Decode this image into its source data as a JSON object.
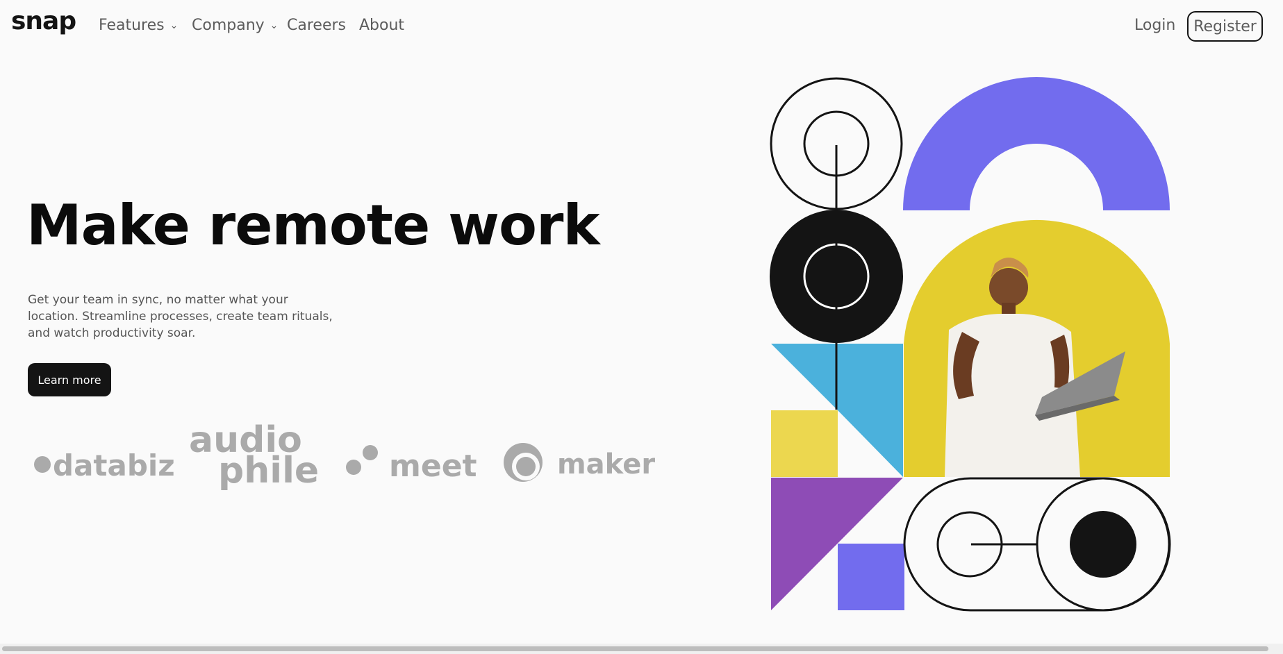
{
  "nav": {
    "logo": "snap",
    "items": [
      {
        "label": "Features",
        "chevron": "⌄"
      },
      {
        "label": "Company",
        "chevron": "⌄"
      },
      {
        "label": "Careers"
      },
      {
        "label": "About"
      }
    ],
    "login": "Login",
    "register": "Register"
  },
  "hero": {
    "title": "Make remote work",
    "text": "Get your team in sync, no matter what your location. Streamline processes, create team rituals, and watch productivity soar.",
    "cta": "Learn more"
  },
  "clients": {
    "databiz": "databiz",
    "audiophile_1": "audio",
    "audiophile_2": "phile",
    "meet": "meet",
    "maker": "maker"
  },
  "colors": {
    "purple": "#726cee",
    "yellow_circle": "#e4cd2e",
    "blue": "#4bb1dc",
    "yellow_square": "#ecd74f",
    "violet": "#8e4cb6",
    "black": "#141414"
  }
}
